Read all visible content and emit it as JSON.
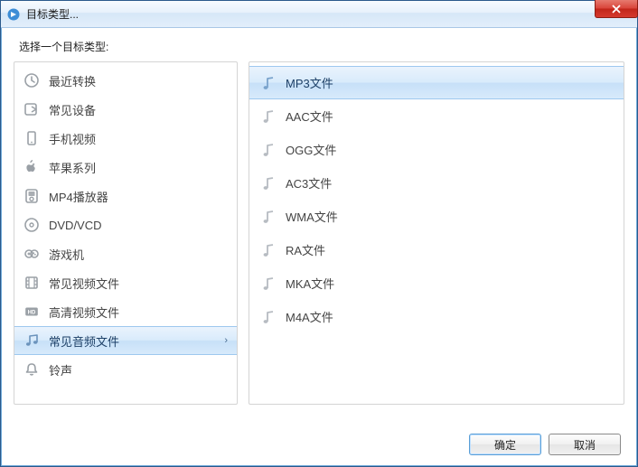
{
  "window": {
    "title": "目标类型..."
  },
  "instruction": "选择一个目标类型:",
  "categories": [
    {
      "label": "最近转换",
      "icon": "clock-icon"
    },
    {
      "label": "常见设备",
      "icon": "device-out-icon"
    },
    {
      "label": "手机视频",
      "icon": "phone-icon"
    },
    {
      "label": "苹果系列",
      "icon": "apple-icon"
    },
    {
      "label": "MP4播放器",
      "icon": "player-icon"
    },
    {
      "label": "DVD/VCD",
      "icon": "disc-icon"
    },
    {
      "label": "游戏机",
      "icon": "gamepad-icon"
    },
    {
      "label": "常见视频文件",
      "icon": "film-icon"
    },
    {
      "label": "高清视频文件",
      "icon": "hd-icon"
    },
    {
      "label": "常见音频文件",
      "icon": "music-icon",
      "selected": true
    },
    {
      "label": "铃声",
      "icon": "bell-icon"
    }
  ],
  "formats": [
    {
      "label": "MP3文件",
      "selected": true
    },
    {
      "label": "AAC文件"
    },
    {
      "label": "OGG文件"
    },
    {
      "label": "AC3文件"
    },
    {
      "label": "WMA文件"
    },
    {
      "label": "RA文件"
    },
    {
      "label": "MKA文件"
    },
    {
      "label": "M4A文件"
    }
  ],
  "buttons": {
    "ok": "确定",
    "cancel": "取消"
  },
  "chevron": "›"
}
